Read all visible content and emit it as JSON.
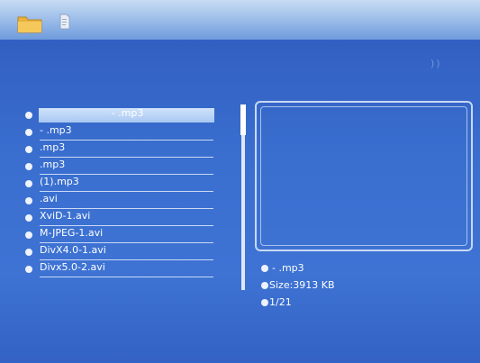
{
  "toolbar": {
    "folder_icon": "folder-icon",
    "file_icon": "file-icon"
  },
  "corner_mark": "))",
  "files": [
    {
      "label": "- .mp3",
      "selected": true
    },
    {
      "label": " - .mp3",
      "selected": false
    },
    {
      "label": ".mp3",
      "selected": false
    },
    {
      "label": ".mp3",
      "selected": false
    },
    {
      "label": "(1).mp3",
      "selected": false
    },
    {
      "label": ".avi",
      "selected": false
    },
    {
      "label": "XviD-1.avi",
      "selected": false
    },
    {
      "label": "M-JPEG-1.avi",
      "selected": false
    },
    {
      "label": "DivX4.0-1.avi",
      "selected": false
    },
    {
      "label": "Divx5.0-2.avi",
      "selected": false
    }
  ],
  "info": {
    "name": "- .mp3",
    "size": "Size:3913 KB",
    "index": "1/21"
  },
  "colors": {
    "background": "#3a6fd0",
    "topbar": "#9fc0ea",
    "text": "#ffffff",
    "highlight": "#b7d2f5"
  }
}
